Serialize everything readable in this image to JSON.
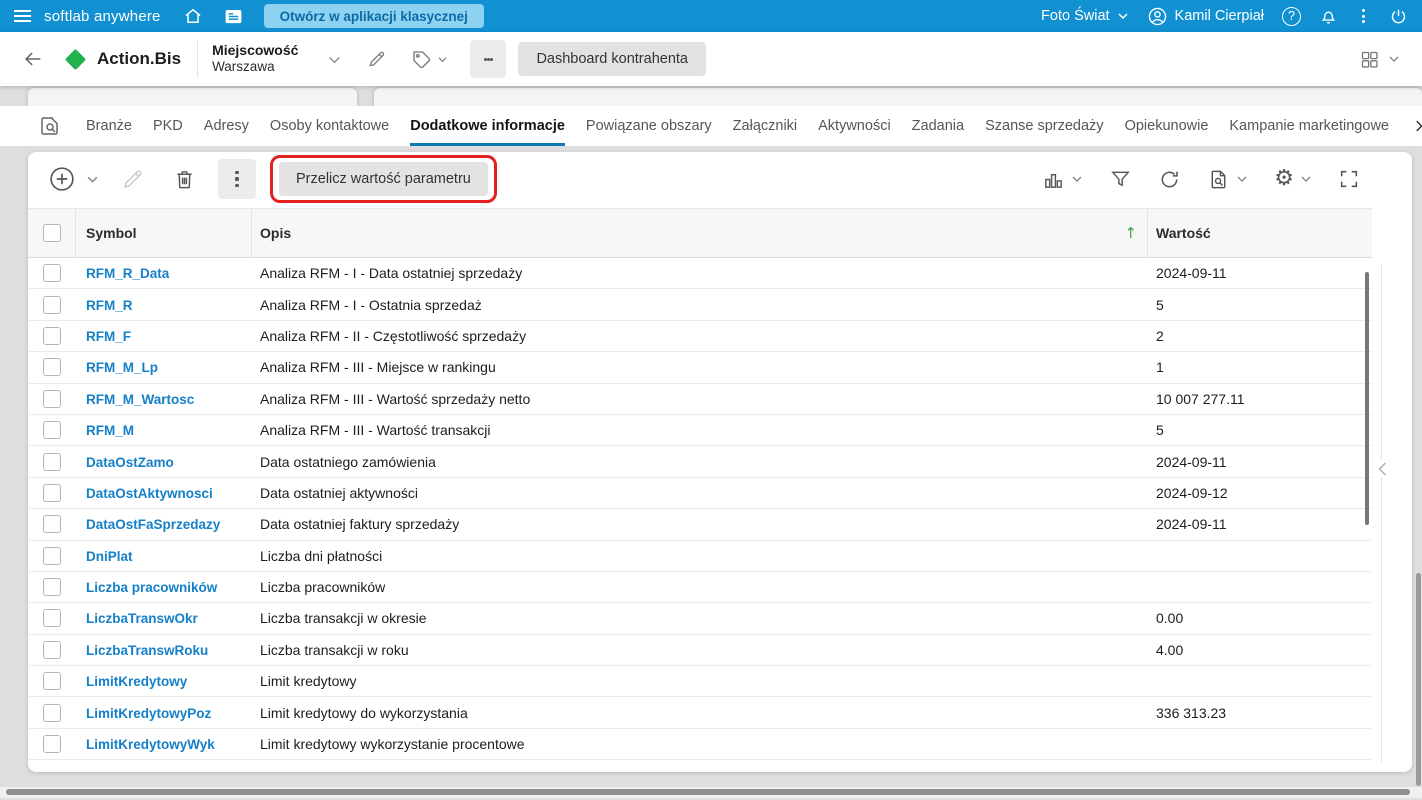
{
  "colors": {
    "topbar_blue": "#1191d2",
    "open_classic_bg": "#8ed2f2",
    "open_classic_text": "#0b6ba6",
    "accent_blue": "#0d7ab5",
    "link_blue": "#1580c8",
    "diamond_green": "#22b14c",
    "sort_green": "#43a047",
    "highlight_red": "#e3201e"
  },
  "topbar": {
    "app_name": "softlab anywhere",
    "open_classic_label": "Otwórz w aplikacji klasycznej",
    "company": "Foto Świat",
    "user": "Kamil Cierpiał"
  },
  "header": {
    "entity": "Action.Bis",
    "field_label": "Miejscowość",
    "field_value": "Warszawa",
    "dashboard_button": "Dashboard kontrahenta"
  },
  "tabs": {
    "items": [
      {
        "label": "Branże",
        "active": false
      },
      {
        "label": "PKD",
        "active": false
      },
      {
        "label": "Adresy",
        "active": false
      },
      {
        "label": "Osoby kontaktowe",
        "active": false
      },
      {
        "label": "Dodatkowe informacje",
        "active": true
      },
      {
        "label": "Powiązane obszary",
        "active": false
      },
      {
        "label": "Załączniki",
        "active": false
      },
      {
        "label": "Aktywności",
        "active": false
      },
      {
        "label": "Zadania",
        "active": false
      },
      {
        "label": "Szanse sprzedaży",
        "active": false
      },
      {
        "label": "Opiekunowie",
        "active": false
      },
      {
        "label": "Kampanie marketingowe",
        "active": false
      }
    ]
  },
  "toolbar": {
    "recalc_button": "Przelicz wartość parametru"
  },
  "table": {
    "columns": {
      "symbol": "Symbol",
      "opis": "Opis",
      "wartosc": "Wartość"
    },
    "sort_arrow": "↑",
    "rows": [
      {
        "symbol": "RFM_R_Data",
        "opis": "Analiza RFM - I - Data ostatniej sprzedaży",
        "wartosc": "2024-09-11"
      },
      {
        "symbol": "RFM_R",
        "opis": "Analiza RFM - I - Ostatnia sprzedaż",
        "wartosc": "5"
      },
      {
        "symbol": "RFM_F",
        "opis": "Analiza RFM - II - Częstotliwość sprzedaży",
        "wartosc": "2"
      },
      {
        "symbol": "RFM_M_Lp",
        "opis": "Analiza RFM - III - Miejsce w rankingu",
        "wartosc": "1"
      },
      {
        "symbol": "RFM_M_Wartosc",
        "opis": "Analiza RFM - III - Wartość sprzedaży netto",
        "wartosc": "10 007 277.11"
      },
      {
        "symbol": "RFM_M",
        "opis": "Analiza RFM - III - Wartość transakcji",
        "wartosc": "5"
      },
      {
        "symbol": "DataOstZamo",
        "opis": "Data ostatniego zamówienia",
        "wartosc": "2024-09-11"
      },
      {
        "symbol": "DataOstAktywnosci",
        "opis": "Data ostatniej aktywności",
        "wartosc": "2024-09-12"
      },
      {
        "symbol": "DataOstFaSprzedazy",
        "opis": "Data ostatniej faktury sprzedaży",
        "wartosc": "2024-09-11"
      },
      {
        "symbol": "DniPlat",
        "opis": "Liczba dni płatności",
        "wartosc": ""
      },
      {
        "symbol": "Liczba pracowników",
        "opis": "Liczba pracowników",
        "wartosc": ""
      },
      {
        "symbol": "LiczbaTranswOkr",
        "opis": "Liczba transakcji w okresie",
        "wartosc": "0.00"
      },
      {
        "symbol": "LiczbaTranswRoku",
        "opis": "Liczba transakcji w roku",
        "wartosc": "4.00"
      },
      {
        "symbol": "LimitKredytowy",
        "opis": "Limit kredytowy",
        "wartosc": ""
      },
      {
        "symbol": "LimitKredytowyPoz",
        "opis": "Limit kredytowy do wykorzystania",
        "wartosc": "336 313.23"
      },
      {
        "symbol": "LimitKredytowyWyk",
        "opis": "Limit kredytowy wykorzystanie procentowe",
        "wartosc": ""
      }
    ]
  }
}
